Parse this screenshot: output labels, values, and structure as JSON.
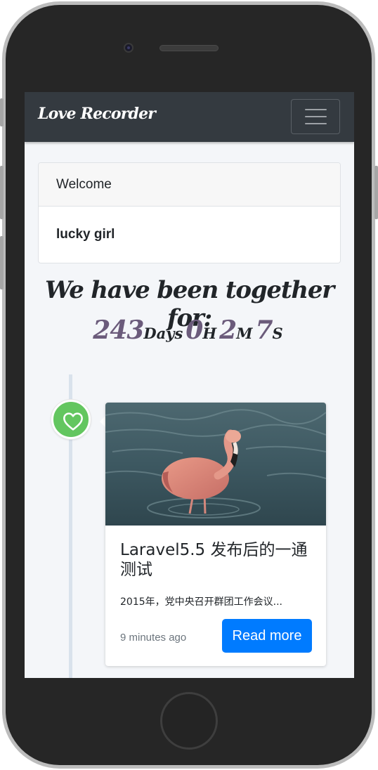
{
  "navbar": {
    "brand": "Love Recorder",
    "menu_icon": "hamburger-icon"
  },
  "welcome_card": {
    "header": "Welcome",
    "body": "lucky girl"
  },
  "together": {
    "heading": "We have been together for:",
    "days": "243",
    "days_unit": "Days",
    "hours": "0",
    "hours_unit": "H",
    "minutes": "2",
    "minutes_unit": "M",
    "seconds": "7",
    "seconds_unit": "S"
  },
  "timeline": {
    "icon": "heart-icon",
    "post": {
      "image": "flamingo-photo",
      "title": "Laravel5.5 发布后的一通测试",
      "excerpt": "2015年，党中央召开群团工作会议...",
      "time": "9 minutes ago",
      "read_more": "Read more"
    }
  },
  "colors": {
    "navbar": "#343a40",
    "accent_button": "#007bff",
    "heart_badge": "#63c65f",
    "counter_number": "#6b5b7b"
  }
}
